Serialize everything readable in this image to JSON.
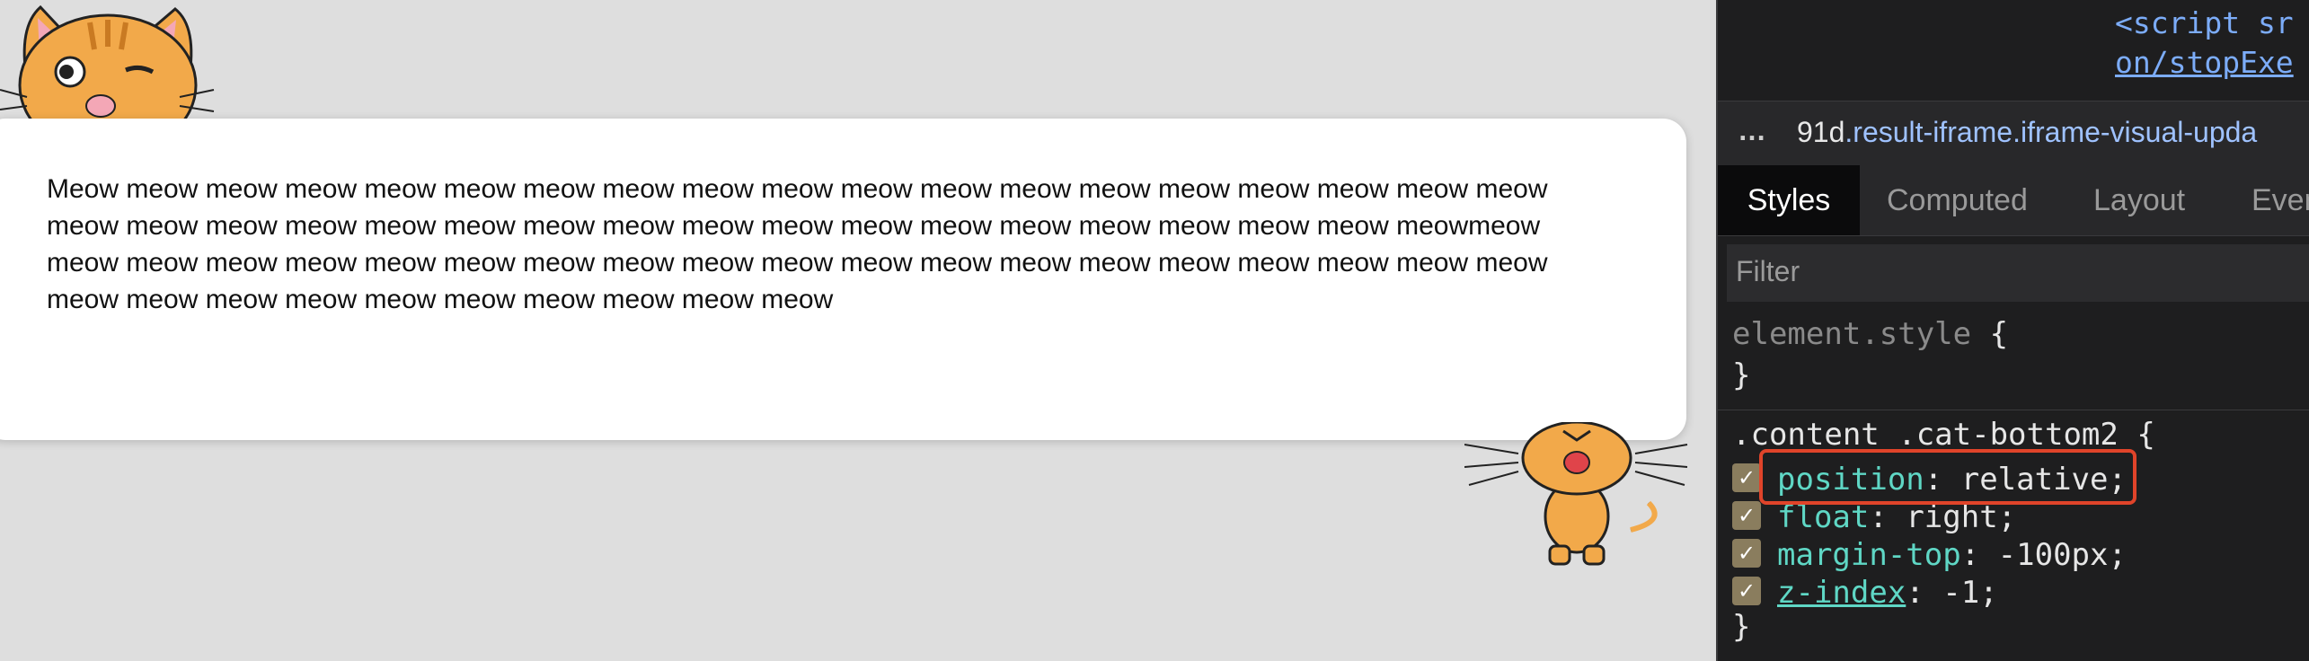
{
  "preview": {
    "card_text": "Meow meow meow meow meow meow meow meow meow meow meow meow meow meow meow meow meow meow meow meow meow meow meow meow meow meow meow meow meow meow meow meow meow meow meow meow meowmeow meow meow meow meow meow meow meow meow meow meow meow meow meow meow meow meow meow meow meow meow meow meow meow meow meow meow meow meow meow"
  },
  "devtools": {
    "elements": {
      "line1": "<script sr",
      "line2": "on/stopExe"
    },
    "breadcrumb": {
      "ellipsis": "…",
      "node_id": "91d",
      "node_classes": ".result-iframe.iframe-visual-upda"
    },
    "tabs": [
      "Styles",
      "Computed",
      "Layout",
      "Even"
    ],
    "active_tab": "Styles",
    "filter_placeholder": "Filter",
    "element_style": {
      "selector": "element.style",
      "open": "{",
      "close": "}"
    },
    "rule": {
      "selector": ".content .cat-bottom2",
      "open": "{",
      "close": "}",
      "declarations": [
        {
          "checked": true,
          "property": "position",
          "value": "relative;"
        },
        {
          "checked": true,
          "property": "float",
          "value": "right;"
        },
        {
          "checked": true,
          "property": "margin-top",
          "value": "-100px;"
        },
        {
          "checked": true,
          "property": "z-index",
          "value": "-1;"
        }
      ]
    },
    "highlight_color": "#e0442a"
  }
}
